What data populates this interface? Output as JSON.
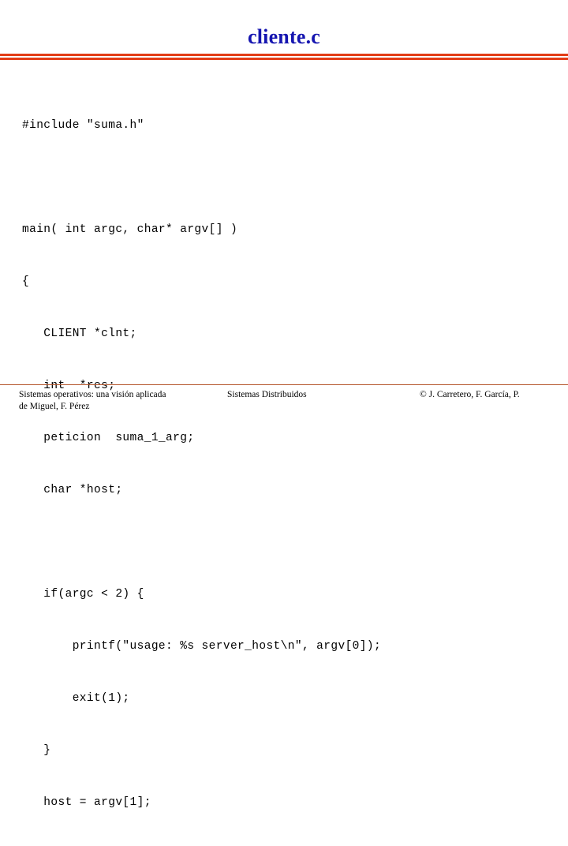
{
  "slide": {
    "title": "cliente.c",
    "title_color": "#1515b0",
    "divider_color": "#e33d17",
    "footer_rule_color": "#b4552b",
    "background": "#ffffff"
  },
  "code": {
    "language": "c",
    "lines": [
      "#include \"suma.h\"",
      "",
      "main( int argc, char* argv[] )",
      "{",
      "   CLIENT *clnt;",
      "   int  *res;",
      "   peticion  suma_1_arg;",
      "   char *host;",
      "",
      "   if(argc < 2) {",
      "       printf(\"usage: %s server_host\\n\", argv[0]);",
      "       exit(1);",
      "   }",
      "   host = argv[1];"
    ]
  },
  "footer": {
    "left_line1": "Sistemas operativos: una visión aplicada",
    "left_line2": "de Miguel, F. Pérez",
    "center": "Sistemas Distribuidos",
    "right": "© J. Carretero, F. García, P."
  }
}
